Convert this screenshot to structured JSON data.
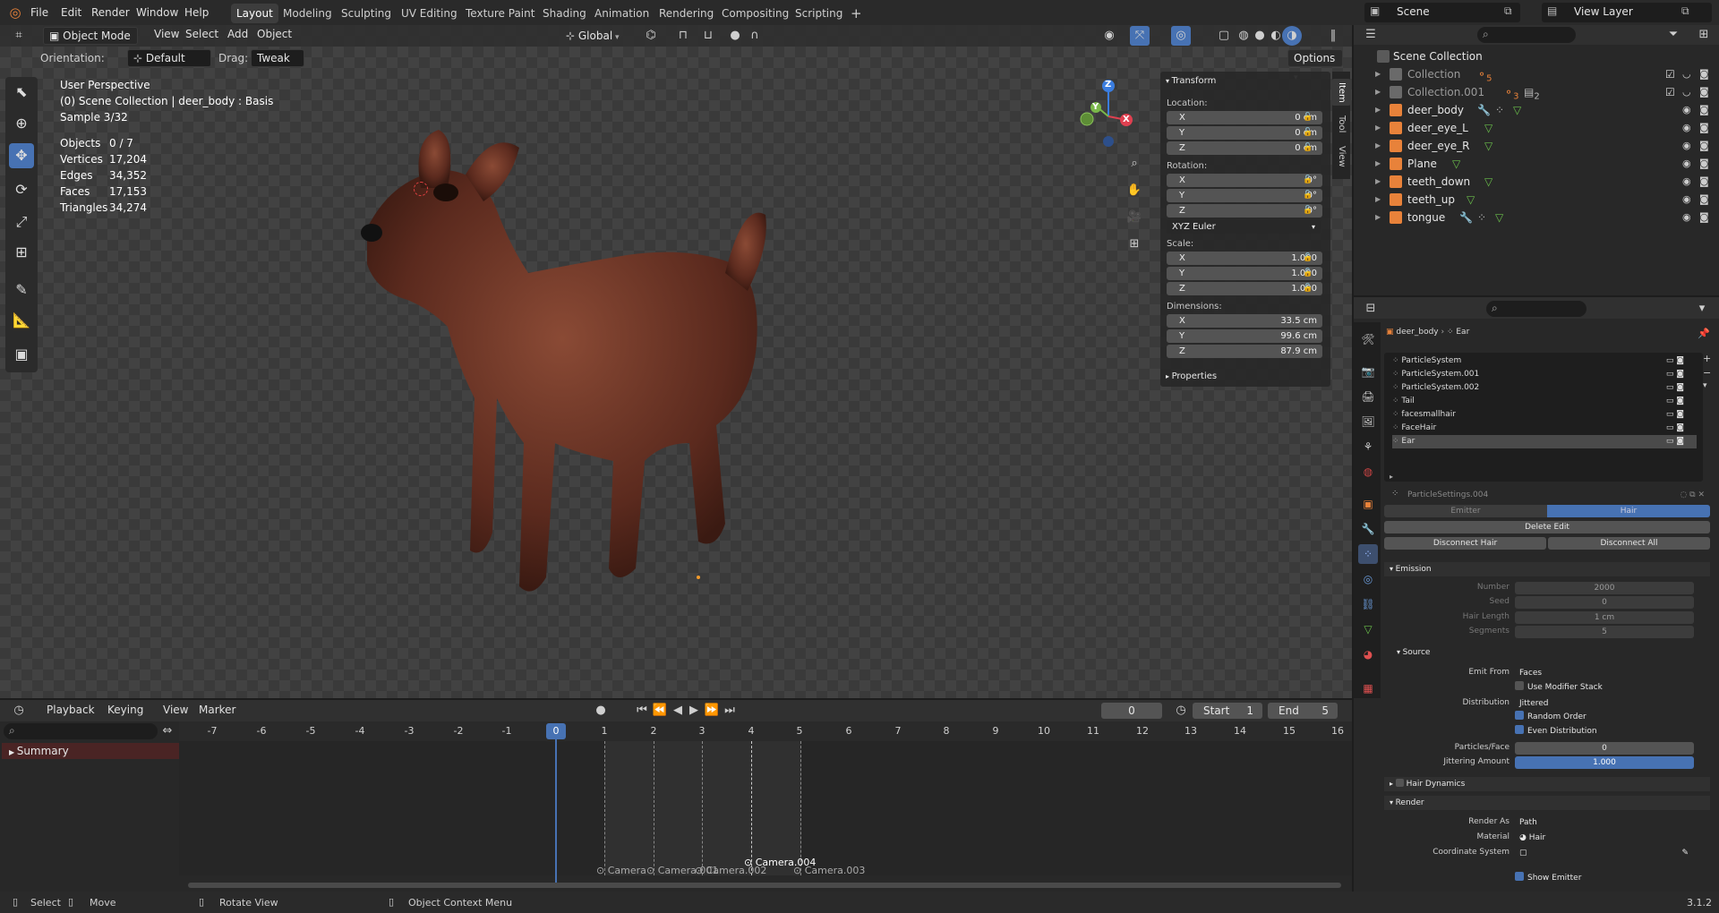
{
  "topbar": {
    "menus": [
      "File",
      "Edit",
      "Render",
      "Window",
      "Help"
    ],
    "workspaces": [
      "Layout",
      "Modeling",
      "Sculpting",
      "UV Editing",
      "Texture Paint",
      "Shading",
      "Animation",
      "Rendering",
      "Compositing",
      "Scripting"
    ],
    "active_workspace": "Layout",
    "add_tab": "+",
    "scene": "Scene",
    "view_layer": "View Layer"
  },
  "viewport_header": {
    "mode": "Object Mode",
    "menus": [
      "View",
      "Select",
      "Add",
      "Object"
    ],
    "transform_orientation": "Global",
    "orientation_label": "Orientation:",
    "orientation_value": "Default",
    "drag_label": "Drag:",
    "drag_value": "Tweak",
    "options": "Options"
  },
  "viewport_overlay": {
    "perspective": "User Perspective",
    "context": "(0) Scene Collection | deer_body : Basis",
    "sample": "Sample 3/32",
    "stats": [
      {
        "label": "Objects",
        "value": "0 / 7"
      },
      {
        "label": "Vertices",
        "value": "17,204"
      },
      {
        "label": "Edges",
        "value": "34,352"
      },
      {
        "label": "Faces",
        "value": "17,153"
      },
      {
        "label": "Triangles",
        "value": "34,274"
      }
    ]
  },
  "gizmo": {
    "x": "X",
    "y": "Y",
    "z": "Z"
  },
  "sidebar_tabs": [
    "Item",
    "Tool",
    "View"
  ],
  "n_panel": {
    "transform_title": "Transform",
    "location_label": "Location:",
    "location": [
      {
        "axis": "X",
        "value": "0 cm"
      },
      {
        "axis": "Y",
        "value": "0 cm"
      },
      {
        "axis": "Z",
        "value": "0 cm"
      }
    ],
    "rotation_label": "Rotation:",
    "rotation": [
      {
        "axis": "X",
        "value": "0°"
      },
      {
        "axis": "Y",
        "value": "0°"
      },
      {
        "axis": "Z",
        "value": "0°"
      }
    ],
    "rotation_mode": "XYZ Euler",
    "scale_label": "Scale:",
    "scale": [
      {
        "axis": "X",
        "value": "1.000"
      },
      {
        "axis": "Y",
        "value": "1.000"
      },
      {
        "axis": "Z",
        "value": "1.000"
      }
    ],
    "dimensions_label": "Dimensions:",
    "dimensions": [
      {
        "axis": "X",
        "value": "33.5 cm"
      },
      {
        "axis": "Y",
        "value": "99.6 cm"
      },
      {
        "axis": "Z",
        "value": "87.9 cm"
      }
    ],
    "properties_title": "Properties"
  },
  "outliner": {
    "root": "Scene Collection",
    "collections": [
      {
        "name": "Collection",
        "badge": "5"
      },
      {
        "name": "Collection.001",
        "badge": "3",
        "badge2": "2"
      }
    ],
    "objects": [
      "deer_body",
      "deer_eye_L",
      "deer_eye_R",
      "Plane",
      "teeth_down",
      "teeth_up",
      "tongue"
    ]
  },
  "properties": {
    "breadcrumb_object": "deer_body",
    "breadcrumb_item": "Ear",
    "particle_systems": [
      "ParticleSystem",
      "ParticleSystem.001",
      "ParticleSystem.002",
      "Tail",
      "facesmallhair",
      "FaceHair",
      "Ear"
    ],
    "selected_system": "Ear",
    "settings_name": "ParticleSettings.004",
    "type_emitter": "Emitter",
    "type_hair": "Hair",
    "delete_edit": "Delete Edit",
    "disconnect_hair": "Disconnect Hair",
    "disconnect_all": "Disconnect All",
    "emission_title": "Emission",
    "emission": [
      {
        "label": "Number",
        "value": "2000"
      },
      {
        "label": "Seed",
        "value": "0"
      },
      {
        "label": "Hair Length",
        "value": "1 cm"
      },
      {
        "label": "Segments",
        "value": "5"
      }
    ],
    "source_title": "Source",
    "emit_from_label": "Emit From",
    "emit_from": "Faces",
    "use_modifier_stack": "Use Modifier Stack",
    "distribution_label": "Distribution",
    "distribution": "Jittered",
    "random_order": "Random Order",
    "even_distribution": "Even Distribution",
    "particles_face_label": "Particles/Face",
    "particles_face": "0",
    "jittering_label": "Jittering Amount",
    "jittering": "1.000",
    "hair_dynamics": "Hair Dynamics",
    "render_title": "Render",
    "render_as_label": "Render As",
    "render_as": "Path",
    "material_label": "Material",
    "material": "Hair",
    "coord_label": "Coordinate System",
    "show_emitter": "Show Emitter"
  },
  "timeline": {
    "menus": [
      "Playback",
      "Keying",
      "View",
      "Marker"
    ],
    "current_frame": "0",
    "start_label": "Start",
    "start": "1",
    "end_label": "End",
    "end": "5",
    "ticks": [
      "-7",
      "-6",
      "-5",
      "-4",
      "-3",
      "-2",
      "-1",
      "0",
      "1",
      "2",
      "3",
      "4",
      "5",
      "6",
      "7",
      "8",
      "9",
      "10",
      "11",
      "12",
      "13",
      "14",
      "15",
      "16"
    ],
    "summary": "Summary",
    "markers": [
      "Camera",
      "Camera.001",
      "Camera.002",
      "Camera.004",
      "Camera.003"
    ]
  },
  "statusbar": {
    "select": "Select",
    "move": "Move",
    "rotate": "Rotate View",
    "context": "Object Context Menu",
    "version": "3.1.2"
  },
  "colors": {
    "accent": "#4772b3",
    "header": "#303030",
    "panel": "#282828",
    "object_orange": "#e8823a",
    "mesh_green": "#6abf4b"
  }
}
